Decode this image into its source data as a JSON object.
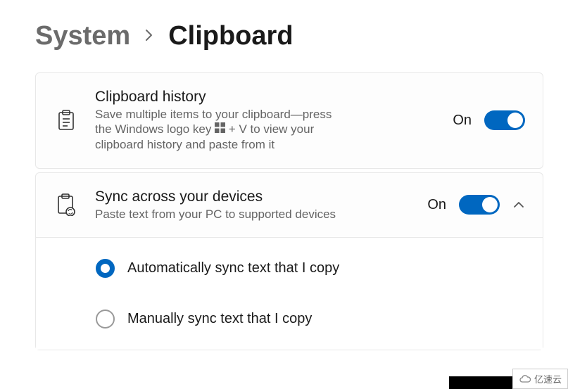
{
  "breadcrumb": {
    "parent": "System",
    "current": "Clipboard"
  },
  "settings": {
    "clipboard_history": {
      "title": "Clipboard history",
      "description_before": "Save multiple items to your clipboard—press the Windows logo key ",
      "description_after": " + V to view your clipboard history and paste from it",
      "state_label": "On",
      "state": true
    },
    "sync": {
      "title": "Sync across your devices",
      "description": "Paste text from your PC to supported devices",
      "state_label": "On",
      "state": true,
      "expanded": true,
      "options": [
        {
          "label": "Automatically sync text that I copy",
          "selected": true
        },
        {
          "label": "Manually sync text that I copy",
          "selected": false
        }
      ]
    }
  },
  "watermark": "亿速云"
}
